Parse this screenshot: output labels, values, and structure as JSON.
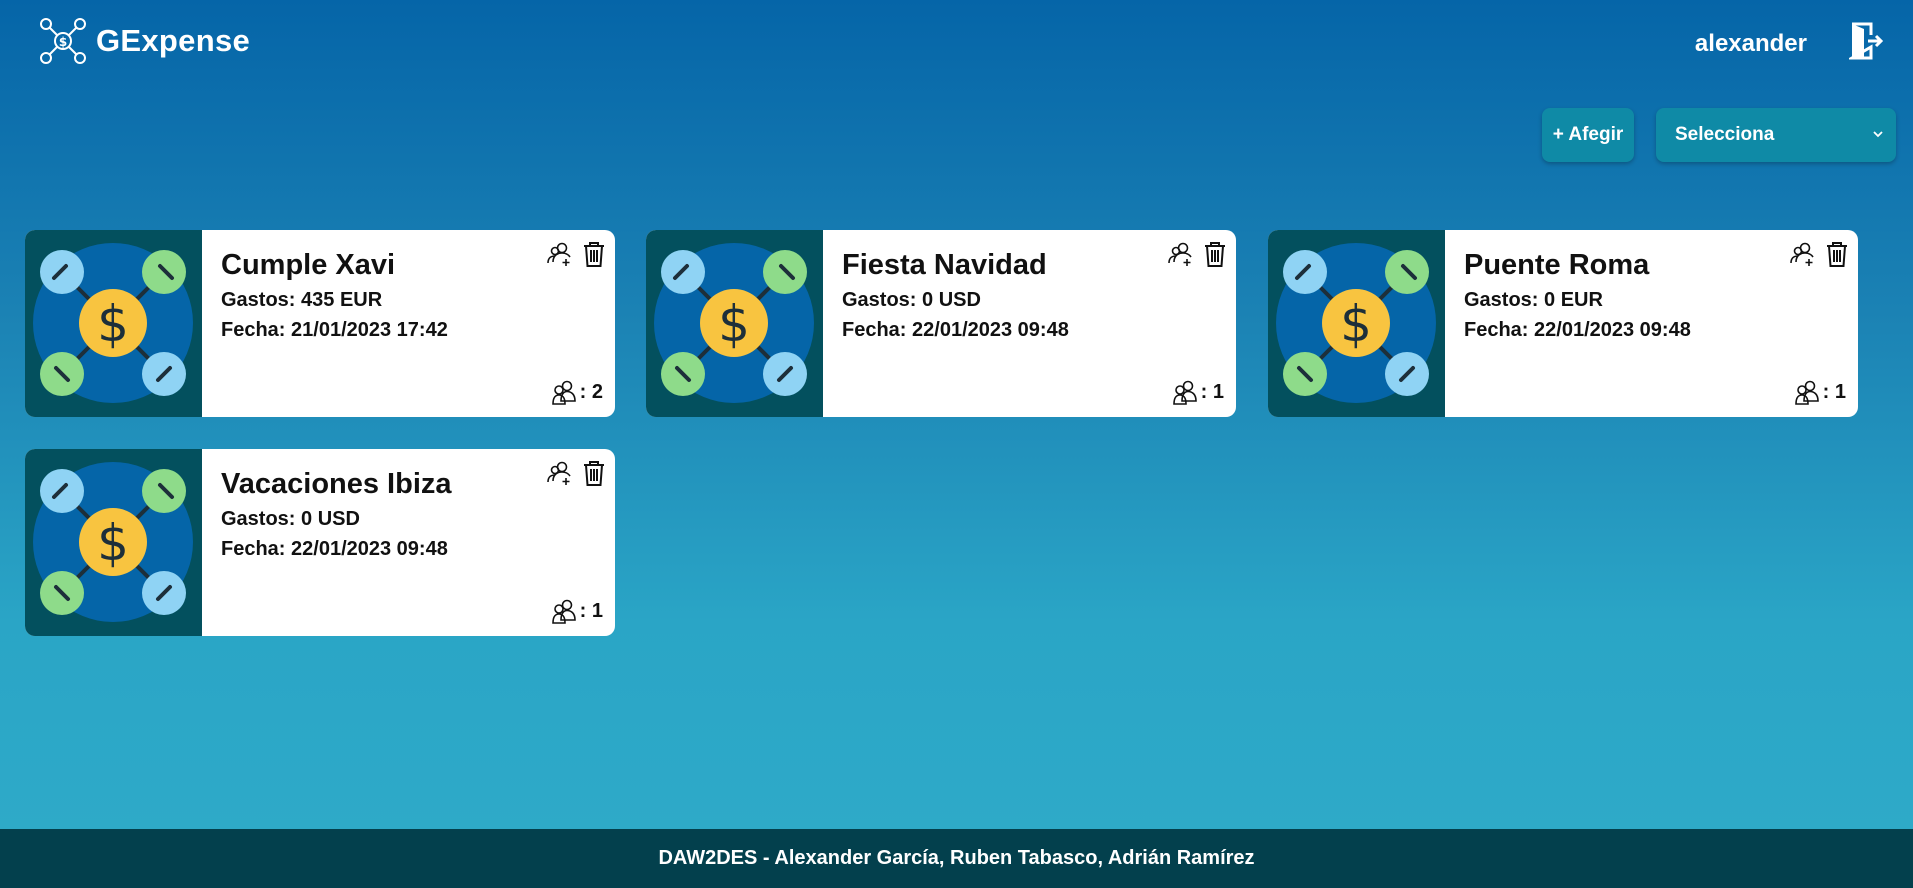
{
  "header": {
    "brand_name": "GExpense",
    "brand_icon": "network-dollar-icon",
    "username": "alexander",
    "logout_icon": "logout-door-icon"
  },
  "toolbar": {
    "add_label": "+ Afegir",
    "select_value": "Selecciona"
  },
  "groups": [
    {
      "title": "Cumple Xavi",
      "gastos": "Gastos: 435 EUR",
      "fecha": "Fecha: 21/01/2023 17:42",
      "members": ": 2"
    },
    {
      "title": "Fiesta Navidad",
      "gastos": "Gastos: 0 USD",
      "fecha": "Fecha: 22/01/2023 09:48",
      "members": ": 1"
    },
    {
      "title": "Puente Roma",
      "gastos": "Gastos: 0 EUR",
      "fecha": "Fecha: 22/01/2023 09:48",
      "members": ": 1"
    },
    {
      "title": "Vacaciones Ibiza",
      "gastos": "Gastos: 0 USD",
      "fecha": "Fecha: 22/01/2023 09:48",
      "members": ": 1"
    }
  ],
  "footer": {
    "text": "DAW2DES - Alexander García, Ruben Tabasco, Adrián Ramírez"
  },
  "colors": {
    "accent": "#0f8aa6",
    "footer_bg": "#03404d",
    "card_image_bg": "#03505e",
    "coin": "#f8c440",
    "node_blue": "#8fd3f4",
    "node_green": "#8edb8a"
  }
}
